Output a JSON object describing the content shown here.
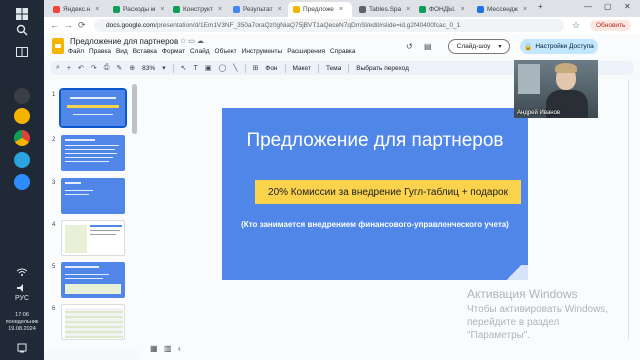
{
  "taskbar": {
    "language": "РУС",
    "time": "17:06",
    "weekday": "понедельник",
    "date": "19.08.2024"
  },
  "browser": {
    "tabs": [
      {
        "label": "Яндекс.н",
        "fav_color": "#f44336"
      },
      {
        "label": "Расходы м",
        "fav_color": "#0f9d58"
      },
      {
        "label": "Конструкт",
        "fav_color": "#0f9d58"
      },
      {
        "label": "Результат",
        "fav_color": "#4285f4"
      },
      {
        "label": "Предложе",
        "fav_color": "#f4b400",
        "active": true
      },
      {
        "label": "Tables.Spa",
        "fav_color": "#5f6368"
      },
      {
        "label": "ФОНДЫ.",
        "fav_color": "#0f9d58"
      },
      {
        "label": "Мессендж",
        "fav_color": "#1a73e8"
      }
    ],
    "url_host": "docs.google.com",
    "url_path": "/presentation/d/1Em1V3NF_350a7oraQz0gNiaQ75jBVT1aQeceN7qDmSl/edit#slide=id.g2f40400fcac_0_1",
    "update_label": "Обновить"
  },
  "app": {
    "doc_title": "Предложение для партнеров",
    "menu": [
      "Файл",
      "Правка",
      "Вид",
      "Вставка",
      "Формат",
      "Слайд",
      "Объект",
      "Инструменты",
      "Расширения",
      "Справка"
    ],
    "slideshow_label": "Слайд-шоу",
    "share_label": "Настройки Доступа"
  },
  "toolbar": {
    "zoom": "83%",
    "background_label": "Фон",
    "layout_label": "Макет",
    "theme_label": "Тема",
    "transition_label": "Выбрать переход"
  },
  "filmstrip": {
    "numbers": [
      "1",
      "2",
      "3",
      "4",
      "5",
      "6"
    ]
  },
  "slide": {
    "title": "Предложение для партнеров",
    "highlight": "20% Комиссии за внедрение Гугл-таблиц + подарок",
    "subtitle": "(Кто занимается внедрением финансового-управленческого учета)"
  },
  "webcam": {
    "name": "Андрей Иванов"
  },
  "watermark": {
    "title": "Активация Windows",
    "line1": "Чтобы активировать Windows,",
    "line2": "перейдите в раздел",
    "line3": "\"Параметры\"."
  }
}
